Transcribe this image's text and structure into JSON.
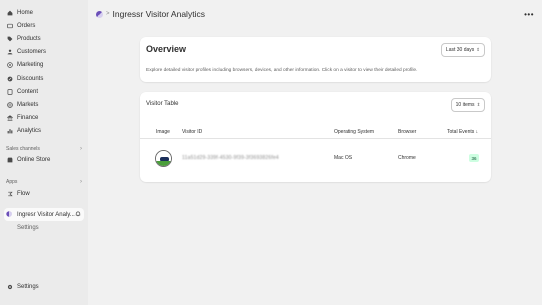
{
  "sidebar": {
    "items": [
      {
        "label": "Home",
        "icon": "home-icon"
      },
      {
        "label": "Orders",
        "icon": "orders-icon"
      },
      {
        "label": "Products",
        "icon": "tag-icon"
      },
      {
        "label": "Customers",
        "icon": "person-icon"
      },
      {
        "label": "Marketing",
        "icon": "target-icon"
      },
      {
        "label": "Discounts",
        "icon": "discount-icon"
      },
      {
        "label": "Content",
        "icon": "content-icon"
      },
      {
        "label": "Markets",
        "icon": "globe-icon"
      },
      {
        "label": "Finance",
        "icon": "bank-icon"
      },
      {
        "label": "Analytics",
        "icon": "chart-icon"
      }
    ],
    "sales_channels_label": "Sales channels",
    "online_store_label": "Online Store",
    "apps_label": "Apps",
    "flow_label": "Flow",
    "active_app_label": "Ingresr Visitor Analy...",
    "active_app_settings": "Settings",
    "settings_label": "Settings"
  },
  "header": {
    "title": "Ingressr Visitor Analytics",
    "more": "•••"
  },
  "overview": {
    "title": "Overview",
    "range_label": "Last 30 days",
    "description": "Explore detailed visitor profiles including browsers, devices, and other information. Click on a visitor to view their detailed profile."
  },
  "visitor_table": {
    "title": "Visitor Table",
    "page_size_label": "10 items",
    "headers": {
      "image": "Image",
      "visitor_id": "Visitor ID",
      "os": "Operating System",
      "browser": "Browser",
      "total_events": "Total Events",
      "sort_indicator": "↓"
    },
    "rows": [
      {
        "visitor_id": "11a51d29-339f-4530-9f39-3f3693826fe4",
        "os": "Mac OS",
        "browser": "Chrome",
        "total_events": "36"
      }
    ]
  },
  "colors": {
    "background": "#f1f1f1",
    "sidebar": "#ebebeb",
    "card": "#ffffff",
    "badge_bg": "#cdfee1",
    "badge_text": "#0c5132",
    "logo": "#6b4fb8"
  }
}
